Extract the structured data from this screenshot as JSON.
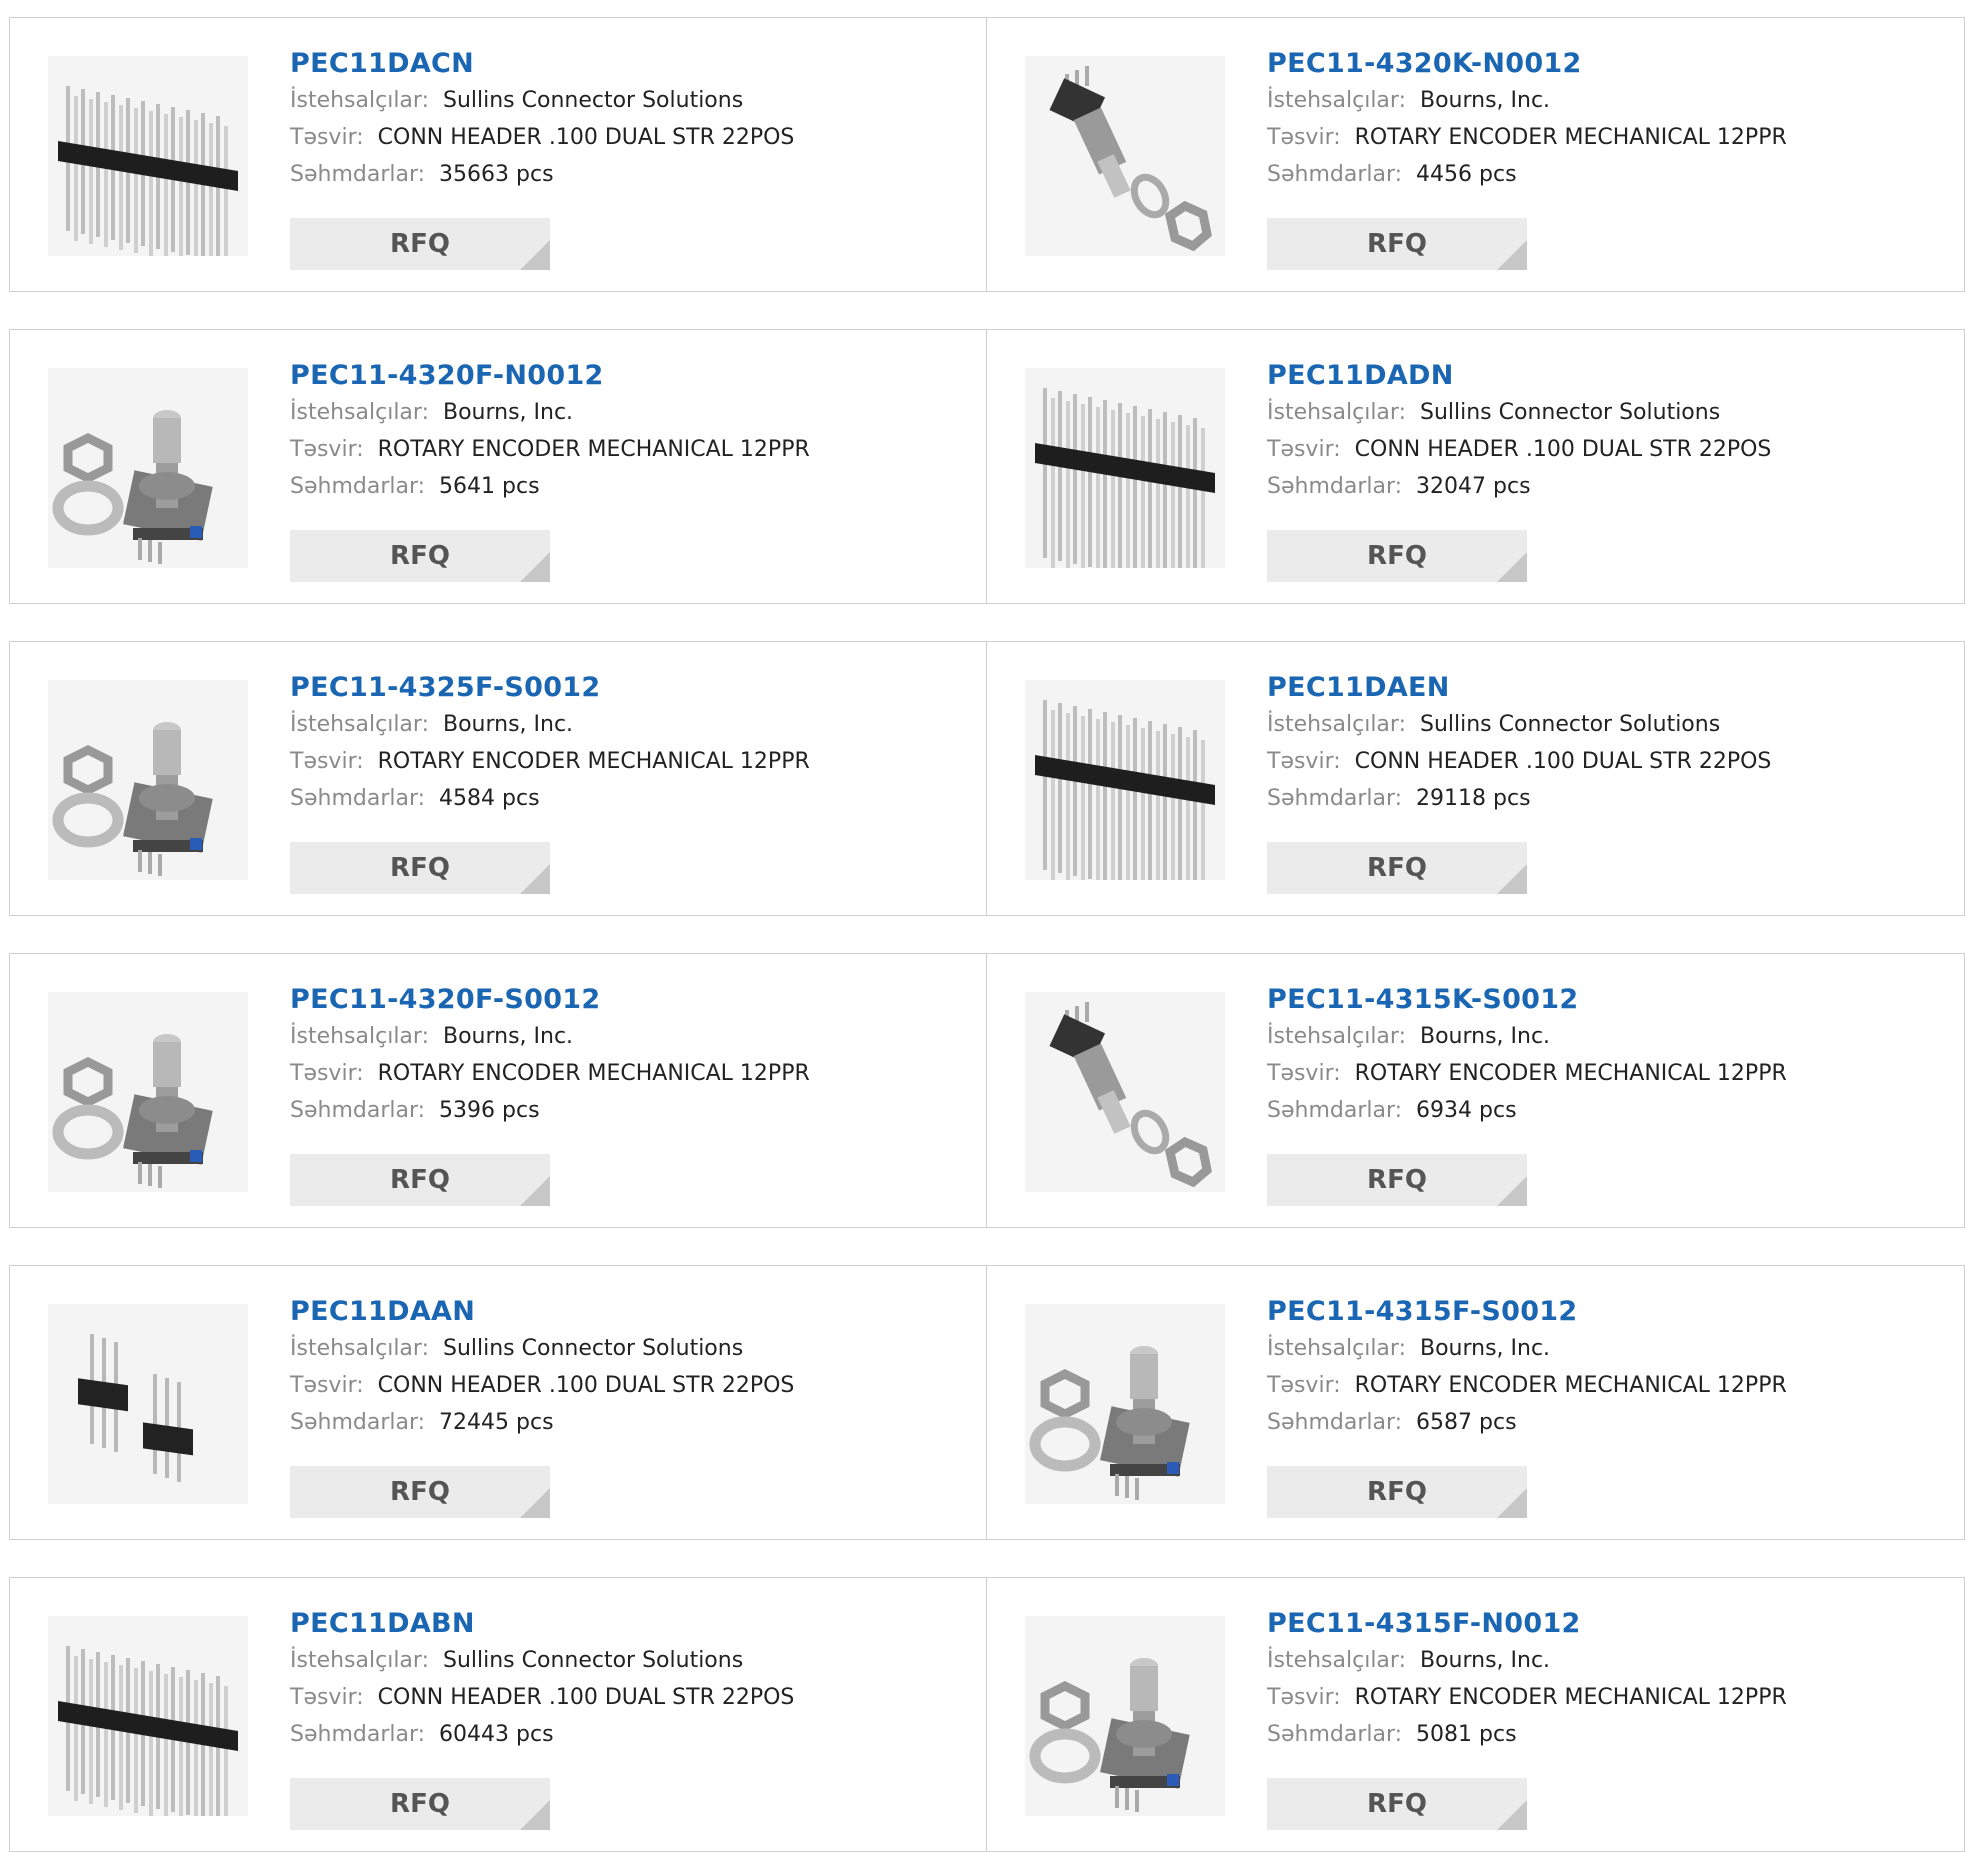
{
  "labels": {
    "manufacturer": "İstehsalçılar:",
    "description": "Təsvir:",
    "stock": "Səhmdarlar:",
    "rfq": "RFQ"
  },
  "colors": {
    "title": "#1a66b3",
    "button_bg": "#ebebeb",
    "border": "#cfcfcf"
  },
  "products": [
    {
      "part": "PEC11DACN",
      "manufacturer": "Sullins Connector Solutions",
      "description": "CONN HEADER .100 DUAL STR 22POS",
      "stock": "35663 pcs",
      "image": "pin-header-icon"
    },
    {
      "part": "PEC11-4320K-N0012",
      "manufacturer": "Bourns, Inc.",
      "description": "ROTARY ENCODER MECHANICAL 12PPR",
      "stock": "4456 pcs",
      "image": "rotary-encoder-side-icon"
    },
    {
      "part": "PEC11-4320F-N0012",
      "manufacturer": "Bourns, Inc.",
      "description": "ROTARY ENCODER MECHANICAL 12PPR",
      "stock": "5641 pcs",
      "image": "rotary-encoder-icon"
    },
    {
      "part": "PEC11DADN",
      "manufacturer": "Sullins Connector Solutions",
      "description": "CONN HEADER .100 DUAL STR 22POS",
      "stock": "32047 pcs",
      "image": "pin-header-long-icon"
    },
    {
      "part": "PEC11-4325F-S0012",
      "manufacturer": "Bourns, Inc.",
      "description": "ROTARY ENCODER MECHANICAL 12PPR",
      "stock": "4584 pcs",
      "image": "rotary-encoder-icon"
    },
    {
      "part": "PEC11DAEN",
      "manufacturer": "Sullins Connector Solutions",
      "description": "CONN HEADER .100 DUAL STR 22POS",
      "stock": "29118 pcs",
      "image": "pin-header-long-icon"
    },
    {
      "part": "PEC11-4320F-S0012",
      "manufacturer": "Bourns, Inc.",
      "description": "ROTARY ENCODER MECHANICAL 12PPR",
      "stock": "5396 pcs",
      "image": "rotary-encoder-icon"
    },
    {
      "part": "PEC11-4315K-S0012",
      "manufacturer": "Bourns, Inc.",
      "description": "ROTARY ENCODER MECHANICAL 12PPR",
      "stock": "6934 pcs",
      "image": "rotary-encoder-side-icon"
    },
    {
      "part": "PEC11DAAN",
      "manufacturer": "Sullins Connector Solutions",
      "description": "CONN HEADER .100 DUAL STR 22POS",
      "stock": "72445 pcs",
      "image": "pin-header-small-icon"
    },
    {
      "part": "PEC11-4315F-S0012",
      "manufacturer": "Bourns, Inc.",
      "description": "ROTARY ENCODER MECHANICAL 12PPR",
      "stock": "6587 pcs",
      "image": "rotary-encoder-icon"
    },
    {
      "part": "PEC11DABN",
      "manufacturer": "Sullins Connector Solutions",
      "description": "CONN HEADER .100 DUAL STR 22POS",
      "stock": "60443 pcs",
      "image": "pin-header-icon"
    },
    {
      "part": "PEC11-4315F-N0012",
      "manufacturer": "Bourns, Inc.",
      "description": "ROTARY ENCODER MECHANICAL 12PPR",
      "stock": "5081 pcs",
      "image": "rotary-encoder-icon"
    }
  ]
}
